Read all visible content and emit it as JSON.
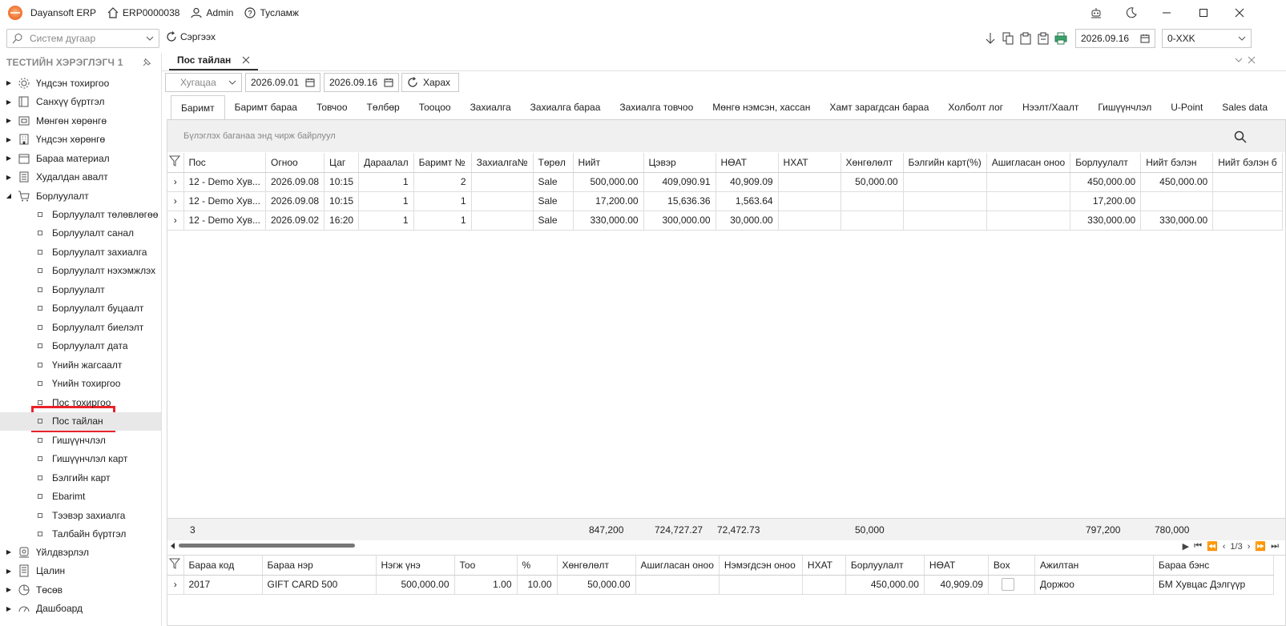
{
  "app": {
    "name": "Dayansoft ERP",
    "company_code": "ERP0000038",
    "user": "Admin",
    "help": "Тусламж"
  },
  "toolbar": {
    "search_placeholder": "Систем дугаар",
    "refresh_label": "Сэргээх",
    "date": "2026.09.16",
    "branch": "0-XXK"
  },
  "sidebar": {
    "title": "ТЕСТИЙН ХЭРЭГЛЭГЧ 1",
    "top_items": [
      {
        "label": "Үндсэн тохиргоо",
        "icon": "gear-icon"
      },
      {
        "label": "Санхүү бүртгэл",
        "icon": "book-icon"
      },
      {
        "label": "Мөнгөн хөрөнгө",
        "icon": "money-icon"
      },
      {
        "label": "Үндсэн хөрөнгө",
        "icon": "building-icon"
      },
      {
        "label": "Бараа материал",
        "icon": "box-icon"
      },
      {
        "label": "Худалдан авалт",
        "icon": "purchase-icon"
      },
      {
        "label": "Борлуулалт",
        "icon": "cart-icon"
      }
    ],
    "sub_items": [
      "Борлуулалт төлөвлөгөө",
      "Борлуулалт санал",
      "Борлуулалт захиалга",
      "Борлуулалт нэхэмжлэх",
      "Борлуулалт",
      "Борлуулалт буцаалт",
      "Борлуулалт биелэлт",
      "Борлуулалт дата",
      "Үнийн жагсаалт",
      "Үнийн тохиргоо",
      "Пос тохиргоо",
      "Пос тайлан",
      "Гишүүнчлэл",
      "Гишүүнчлэл карт",
      "Бэлгийн карт",
      "Ebarimt",
      "Тээвэр захиалга",
      "Талбайн бүртгэл"
    ],
    "bottom_items": [
      {
        "label": "Үйлдвэрлэл",
        "icon": "factory-icon"
      },
      {
        "label": "Цалин",
        "icon": "salary-icon"
      },
      {
        "label": "Төсөв",
        "icon": "budget-icon"
      },
      {
        "label": "Дашбоард",
        "icon": "dashboard-icon"
      }
    ]
  },
  "doc_tab": "Пос тайлан",
  "filter": {
    "period_placeholder": "Хугацаа",
    "date_from": "2026.09.01",
    "date_to": "2026.09.16",
    "view_label": "Харах"
  },
  "subtabs": [
    "Баримт",
    "Баримт бараа",
    "Товчоо",
    "Төлбөр",
    "Тооцоо",
    "Захиалга",
    "Захиалга бараа",
    "Захиалга товчоо",
    "Мөнгө нэмсэн, хассан",
    "Хамт зарагдсан бараа",
    "Холболт лог",
    "Нээлт/Хаалт",
    "Гишүүнчлэл",
    "U-Point",
    "Sales data"
  ],
  "group_hint": "Бүлэглэх баганаа энд чирж байрлуул",
  "main_grid": {
    "columns": [
      "Пос",
      "Огноо",
      "Цаг",
      "Дараалал",
      "Баримт №",
      "Захиалга№",
      "Төрөл",
      "Нийт",
      "Цэвэр",
      "НӨАТ",
      "НХАТ",
      "Хөнгөлөлт",
      "Бэлгийн карт(%)",
      "Ашигласан оноо",
      "Борлуулалт",
      "Нийт бэлэн",
      "Нийт бэлэн б"
    ],
    "rows": [
      [
        "12 - Demo Хув...",
        "2026.09.08",
        "10:15",
        "1",
        "2",
        "",
        "Sale",
        "500,000.00",
        "409,090.91",
        "40,909.09",
        "",
        "50,000.00",
        "",
        "",
        "450,000.00",
        "450,000.00",
        ""
      ],
      [
        "12 - Demo Хув...",
        "2026.09.08",
        "10:15",
        "1",
        "1",
        "",
        "Sale",
        "17,200.00",
        "15,636.36",
        "1,563.64",
        "",
        "",
        "",
        "",
        "17,200.00",
        "",
        ""
      ],
      [
        "12 - Demo Хув...",
        "2026.09.02",
        "16:20",
        "1",
        "1",
        "",
        "Sale",
        "330,000.00",
        "300,000.00",
        "30,000.00",
        "",
        "",
        "",
        "",
        "330,000.00",
        "330,000.00",
        ""
      ]
    ],
    "totals": {
      "count": "3",
      "total": "847,200",
      "net": "724,727.27",
      "vat": "72,472.73",
      "discount": "50,000",
      "sales": "797,200",
      "cash": "780,000"
    }
  },
  "pager": {
    "label": "1/3"
  },
  "detail_grid": {
    "columns": [
      "Бараа код",
      "Бараа нэр",
      "Нэгж үнэ",
      "Тоо",
      "%",
      "Хөнгөлөлт",
      "Ашигласан оноо",
      "Нэмэгдсэн оноо",
      "НХАТ",
      "Борлуулалт",
      "НӨАТ",
      "Box",
      "Ажилтан",
      "Бараа бэнс"
    ],
    "rows": [
      [
        "2017",
        "GIFT CARD 500",
        "500,000.00",
        "1.00",
        "10.00",
        "50,000.00",
        "",
        "",
        "",
        "450,000.00",
        "40,909.09",
        "",
        "Доржоо",
        "БМ Хувцас Дэлгүүр"
      ]
    ]
  },
  "colors": {
    "highlight": "#e8242a",
    "selected_bg": "#e8e8e8"
  }
}
